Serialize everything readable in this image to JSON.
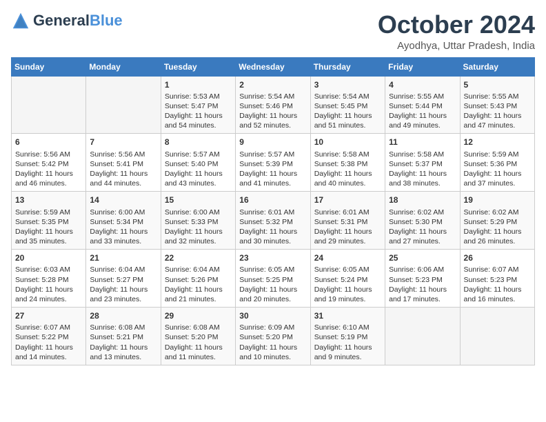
{
  "header": {
    "logo_line1": "General",
    "logo_line2": "Blue",
    "month": "October 2024",
    "location": "Ayodhya, Uttar Pradesh, India"
  },
  "weekdays": [
    "Sunday",
    "Monday",
    "Tuesday",
    "Wednesday",
    "Thursday",
    "Friday",
    "Saturday"
  ],
  "weeks": [
    [
      {
        "day": "",
        "info": ""
      },
      {
        "day": "",
        "info": ""
      },
      {
        "day": "1",
        "info": "Sunrise: 5:53 AM\nSunset: 5:47 PM\nDaylight: 11 hours and 54 minutes."
      },
      {
        "day": "2",
        "info": "Sunrise: 5:54 AM\nSunset: 5:46 PM\nDaylight: 11 hours and 52 minutes."
      },
      {
        "day": "3",
        "info": "Sunrise: 5:54 AM\nSunset: 5:45 PM\nDaylight: 11 hours and 51 minutes."
      },
      {
        "day": "4",
        "info": "Sunrise: 5:55 AM\nSunset: 5:44 PM\nDaylight: 11 hours and 49 minutes."
      },
      {
        "day": "5",
        "info": "Sunrise: 5:55 AM\nSunset: 5:43 PM\nDaylight: 11 hours and 47 minutes."
      }
    ],
    [
      {
        "day": "6",
        "info": "Sunrise: 5:56 AM\nSunset: 5:42 PM\nDaylight: 11 hours and 46 minutes."
      },
      {
        "day": "7",
        "info": "Sunrise: 5:56 AM\nSunset: 5:41 PM\nDaylight: 11 hours and 44 minutes."
      },
      {
        "day": "8",
        "info": "Sunrise: 5:57 AM\nSunset: 5:40 PM\nDaylight: 11 hours and 43 minutes."
      },
      {
        "day": "9",
        "info": "Sunrise: 5:57 AM\nSunset: 5:39 PM\nDaylight: 11 hours and 41 minutes."
      },
      {
        "day": "10",
        "info": "Sunrise: 5:58 AM\nSunset: 5:38 PM\nDaylight: 11 hours and 40 minutes."
      },
      {
        "day": "11",
        "info": "Sunrise: 5:58 AM\nSunset: 5:37 PM\nDaylight: 11 hours and 38 minutes."
      },
      {
        "day": "12",
        "info": "Sunrise: 5:59 AM\nSunset: 5:36 PM\nDaylight: 11 hours and 37 minutes."
      }
    ],
    [
      {
        "day": "13",
        "info": "Sunrise: 5:59 AM\nSunset: 5:35 PM\nDaylight: 11 hours and 35 minutes."
      },
      {
        "day": "14",
        "info": "Sunrise: 6:00 AM\nSunset: 5:34 PM\nDaylight: 11 hours and 33 minutes."
      },
      {
        "day": "15",
        "info": "Sunrise: 6:00 AM\nSunset: 5:33 PM\nDaylight: 11 hours and 32 minutes."
      },
      {
        "day": "16",
        "info": "Sunrise: 6:01 AM\nSunset: 5:32 PM\nDaylight: 11 hours and 30 minutes."
      },
      {
        "day": "17",
        "info": "Sunrise: 6:01 AM\nSunset: 5:31 PM\nDaylight: 11 hours and 29 minutes."
      },
      {
        "day": "18",
        "info": "Sunrise: 6:02 AM\nSunset: 5:30 PM\nDaylight: 11 hours and 27 minutes."
      },
      {
        "day": "19",
        "info": "Sunrise: 6:02 AM\nSunset: 5:29 PM\nDaylight: 11 hours and 26 minutes."
      }
    ],
    [
      {
        "day": "20",
        "info": "Sunrise: 6:03 AM\nSunset: 5:28 PM\nDaylight: 11 hours and 24 minutes."
      },
      {
        "day": "21",
        "info": "Sunrise: 6:04 AM\nSunset: 5:27 PM\nDaylight: 11 hours and 23 minutes."
      },
      {
        "day": "22",
        "info": "Sunrise: 6:04 AM\nSunset: 5:26 PM\nDaylight: 11 hours and 21 minutes."
      },
      {
        "day": "23",
        "info": "Sunrise: 6:05 AM\nSunset: 5:25 PM\nDaylight: 11 hours and 20 minutes."
      },
      {
        "day": "24",
        "info": "Sunrise: 6:05 AM\nSunset: 5:24 PM\nDaylight: 11 hours and 19 minutes."
      },
      {
        "day": "25",
        "info": "Sunrise: 6:06 AM\nSunset: 5:23 PM\nDaylight: 11 hours and 17 minutes."
      },
      {
        "day": "26",
        "info": "Sunrise: 6:07 AM\nSunset: 5:23 PM\nDaylight: 11 hours and 16 minutes."
      }
    ],
    [
      {
        "day": "27",
        "info": "Sunrise: 6:07 AM\nSunset: 5:22 PM\nDaylight: 11 hours and 14 minutes."
      },
      {
        "day": "28",
        "info": "Sunrise: 6:08 AM\nSunset: 5:21 PM\nDaylight: 11 hours and 13 minutes."
      },
      {
        "day": "29",
        "info": "Sunrise: 6:08 AM\nSunset: 5:20 PM\nDaylight: 11 hours and 11 minutes."
      },
      {
        "day": "30",
        "info": "Sunrise: 6:09 AM\nSunset: 5:20 PM\nDaylight: 11 hours and 10 minutes."
      },
      {
        "day": "31",
        "info": "Sunrise: 6:10 AM\nSunset: 5:19 PM\nDaylight: 11 hours and 9 minutes."
      },
      {
        "day": "",
        "info": ""
      },
      {
        "day": "",
        "info": ""
      }
    ]
  ]
}
